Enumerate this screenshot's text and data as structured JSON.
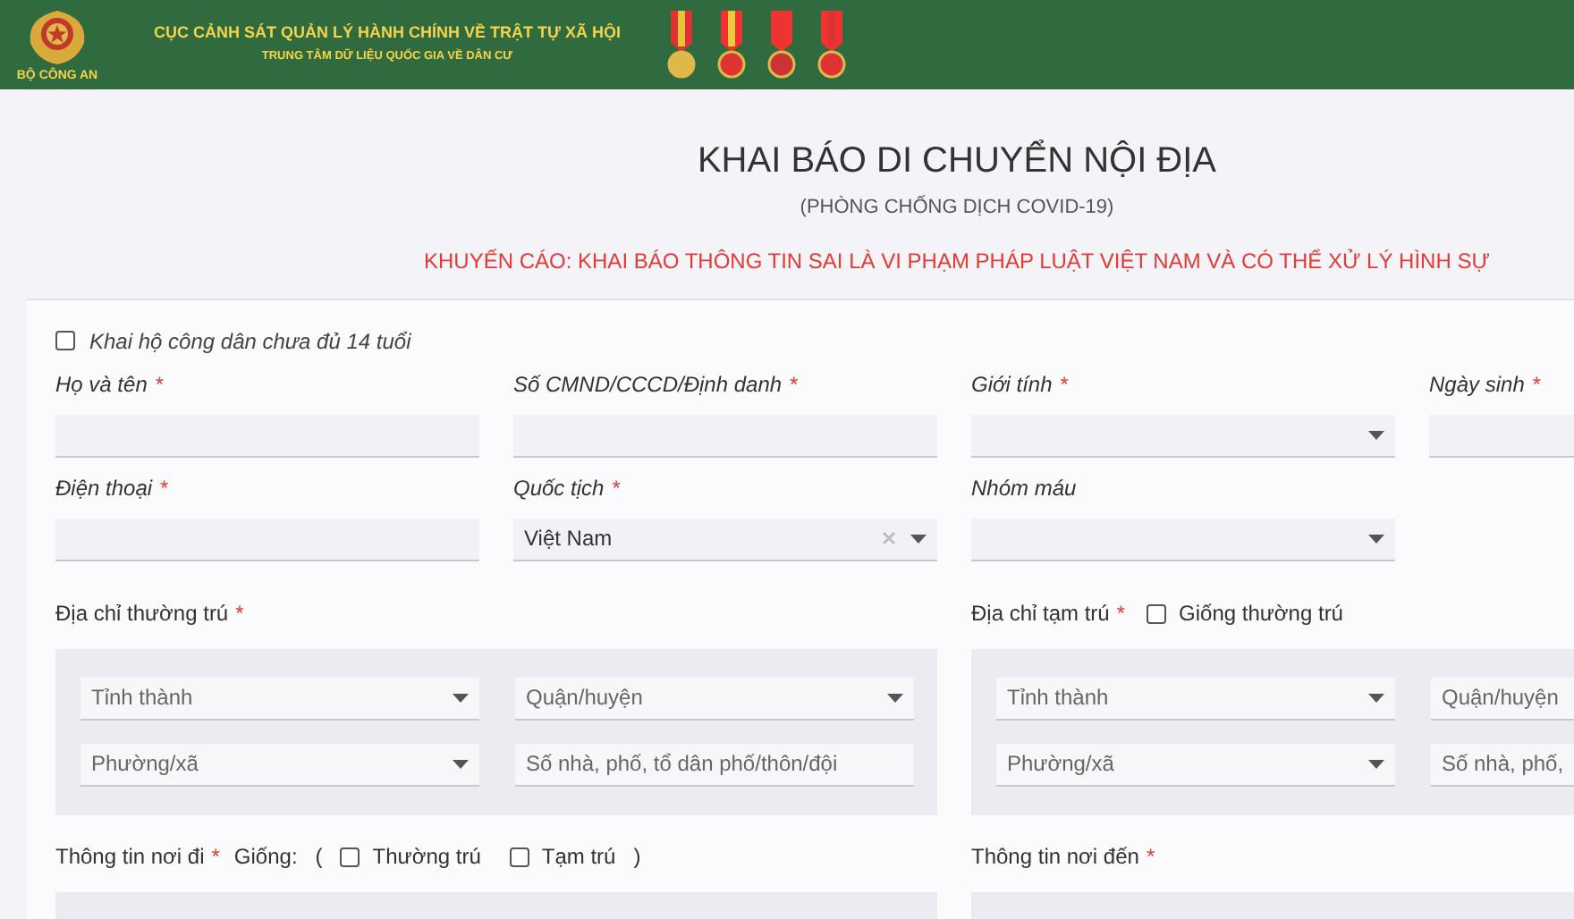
{
  "header": {
    "logo_caption": "BỘ CÔNG AN",
    "agency": "CỤC CẢNH SÁT QUẢN LÝ HÀNH CHÍNH VỀ TRẬT TỰ XÃ HỘI",
    "center": "TRUNG TÂM DỮ LIỆU QUỐC GIA VỀ DÂN CƯ"
  },
  "title": "KHAI BÁO DI CHUYỂN NỘI ĐỊA",
  "subtitle": "(PHÒNG CHỐNG DỊCH COVID-19)",
  "warning": "KHUYẾN CÁO: KHAI BÁO THÔNG TIN SAI LÀ VI PHẠM PHÁP LUẬT VIỆT NAM VÀ CÓ THỂ XỬ LÝ HÌNH SỰ",
  "proxy_checkbox": {
    "label": "Khai hộ công dân chưa đủ 14 tuổi",
    "checked": false
  },
  "fields": [
    {
      "label": "Họ và tên",
      "required_mark": "*",
      "kind": "text"
    },
    {
      "label": "Số CMND/CCCD/Định danh",
      "required_mark": "*",
      "kind": "text"
    },
    {
      "label": "Giới tính",
      "required_mark": "*",
      "kind": "select"
    },
    {
      "label": "Ngày sinh",
      "required_mark": "*",
      "kind": "text"
    },
    {
      "label": "Điện thoại",
      "required_mark": "*",
      "kind": "text"
    },
    {
      "label": "Quốc tịch",
      "required_mark": "*",
      "kind": "select",
      "value": "Việt Nam",
      "clearable": true
    },
    {
      "label": "Nhóm máu",
      "kind": "select"
    }
  ],
  "addresses": [
    {
      "label": "Địa chỉ thường trú",
      "required_mark": "*",
      "inputs": [
        {
          "kind": "select",
          "placeholder": "Tỉnh thành"
        },
        {
          "kind": "select",
          "placeholder": "Quận/huyện"
        },
        {
          "kind": "select",
          "placeholder": "Phường/xã"
        },
        {
          "kind": "text",
          "placeholder": "Số nhà, phố, tổ dân phố/thôn/đội"
        }
      ]
    },
    {
      "label": "Địa chỉ tạm trú",
      "required_mark": "*",
      "same_as": {
        "label": "Giống thường trú",
        "checked": false
      },
      "inputs": [
        {
          "kind": "select",
          "placeholder": "Tỉnh thành"
        },
        {
          "kind": "select",
          "placeholder": "Quận/huyện"
        },
        {
          "kind": "select",
          "placeholder": "Phường/xã"
        },
        {
          "kind": "text",
          "placeholder": "Số nhà, phố,"
        }
      ]
    }
  ],
  "travel": [
    {
      "label": "Thông tin nơi đi",
      "required_mark": "*",
      "same": {
        "label": "Giống:",
        "open": "(",
        "close": ")",
        "options": [
          {
            "label": "Thường trú",
            "checked": false
          },
          {
            "label": "Tạm trú",
            "checked": false
          }
        ]
      }
    },
    {
      "label": "Thông tin nơi đến",
      "required_mark": "*"
    }
  ]
}
